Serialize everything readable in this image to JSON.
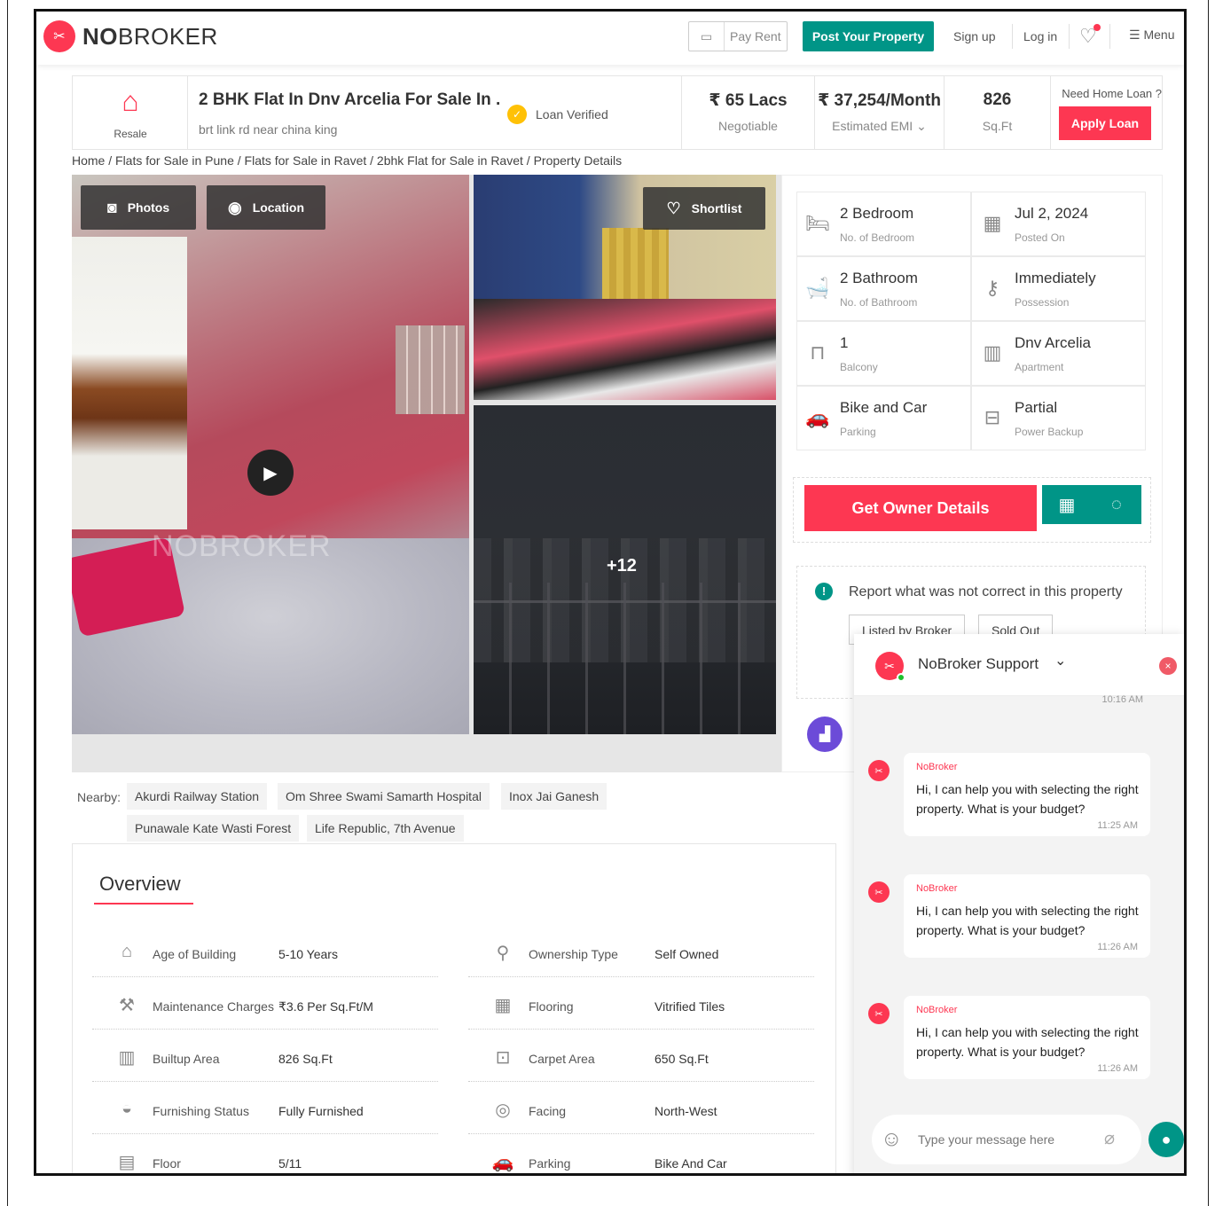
{
  "header": {
    "brand_bold": "NO",
    "brand_rest": "BROKER",
    "pay_rent": "Pay Rent",
    "post_property": "Post Your Property",
    "sign_up": "Sign up",
    "log_in": "Log in",
    "menu": "Menu"
  },
  "property": {
    "type_label": "Resale",
    "title": "2 BHK Flat In Dnv Arcelia For Sale In ...",
    "address": "brt link rd near china king",
    "loan_verified": "Loan Verified",
    "price": "₹ 65 Lacs",
    "price_sub": "Negotiable",
    "emi": "₹ 37,254/Month",
    "emi_sub": "Estimated EMI",
    "area": "826",
    "area_sub": "Sq.Ft",
    "need_loan": "Need Home Loan ?",
    "apply_loan": "Apply Loan"
  },
  "breadcrumb": "Home / Flats for Sale in Pune / Flats for Sale in Ravet / 2bhk Flat for Sale in Ravet / Property Details",
  "gallery": {
    "photos": "Photos",
    "location": "Location",
    "shortlist": "Shortlist",
    "more_count": "+12",
    "watermark": "NOBROKER"
  },
  "details": [
    {
      "value": "2 Bedroom",
      "label": "No. of Bedroom",
      "icon": "bed-icon"
    },
    {
      "value": "Jul 2, 2024",
      "label": "Posted On",
      "icon": "calendar-icon"
    },
    {
      "value": "2 Bathroom",
      "label": "No. of Bathroom",
      "icon": "bathtub-icon"
    },
    {
      "value": "Immediately",
      "label": "Possession",
      "icon": "key-icon"
    },
    {
      "value": "1",
      "label": "Balcony",
      "icon": "balcony-icon"
    },
    {
      "value": "Dnv Arcelia",
      "label": "Apartment",
      "icon": "building-icon"
    },
    {
      "value": "Bike and Car",
      "label": "Parking",
      "icon": "car-icon"
    },
    {
      "value": "Partial",
      "label": "Power Backup",
      "icon": "battery-icon"
    }
  ],
  "owner": {
    "get_details": "Get Owner Details"
  },
  "report": {
    "text": "Report what was not correct in this property",
    "tag1": "Listed by Broker",
    "tag2": "Sold Out"
  },
  "nearby": {
    "label": "Nearby:",
    "places": [
      "Akurdi Railway Station",
      "Om Shree Swami Samarth Hospital",
      "Inox Jai Ganesh",
      "Punawale Kate Wasti Forest",
      "Life Republic, 7th Avenue"
    ]
  },
  "overview": {
    "title": "Overview",
    "left": [
      {
        "key": "Age of Building",
        "value": "5-10 Years"
      },
      {
        "key": "Maintenance Charges",
        "value": "₹3.6 Per Sq.Ft/M"
      },
      {
        "key": "Builtup Area",
        "value": "826 Sq.Ft"
      },
      {
        "key": "Furnishing Status",
        "value": "Fully Furnished"
      },
      {
        "key": "Floor",
        "value": "5/11"
      }
    ],
    "right": [
      {
        "key": "Ownership Type",
        "value": "Self Owned"
      },
      {
        "key": "Flooring",
        "value": "Vitrified Tiles"
      },
      {
        "key": "Carpet Area",
        "value": "650 Sq.Ft"
      },
      {
        "key": "Facing",
        "value": "North-West"
      },
      {
        "key": "Parking",
        "value": "Bike And Car"
      }
    ]
  },
  "chat": {
    "title": "NoBroker Support",
    "top_time": "10:16 AM",
    "messages": [
      {
        "sender": "NoBroker",
        "text": "Hi, I can help you with selecting the right property. What is your budget?",
        "time": "11:25 AM"
      },
      {
        "sender": "NoBroker",
        "text": "Hi, I can help you with selecting the right property. What is your budget?",
        "time": "11:26 AM"
      },
      {
        "sender": "NoBroker",
        "text": "Hi, I can help you with selecting the right property. What is your budget?",
        "time": "11:26 AM"
      }
    ],
    "placeholder": "Type your message here"
  },
  "colors": {
    "brand_red": "#fd3752",
    "teal": "#009587"
  }
}
